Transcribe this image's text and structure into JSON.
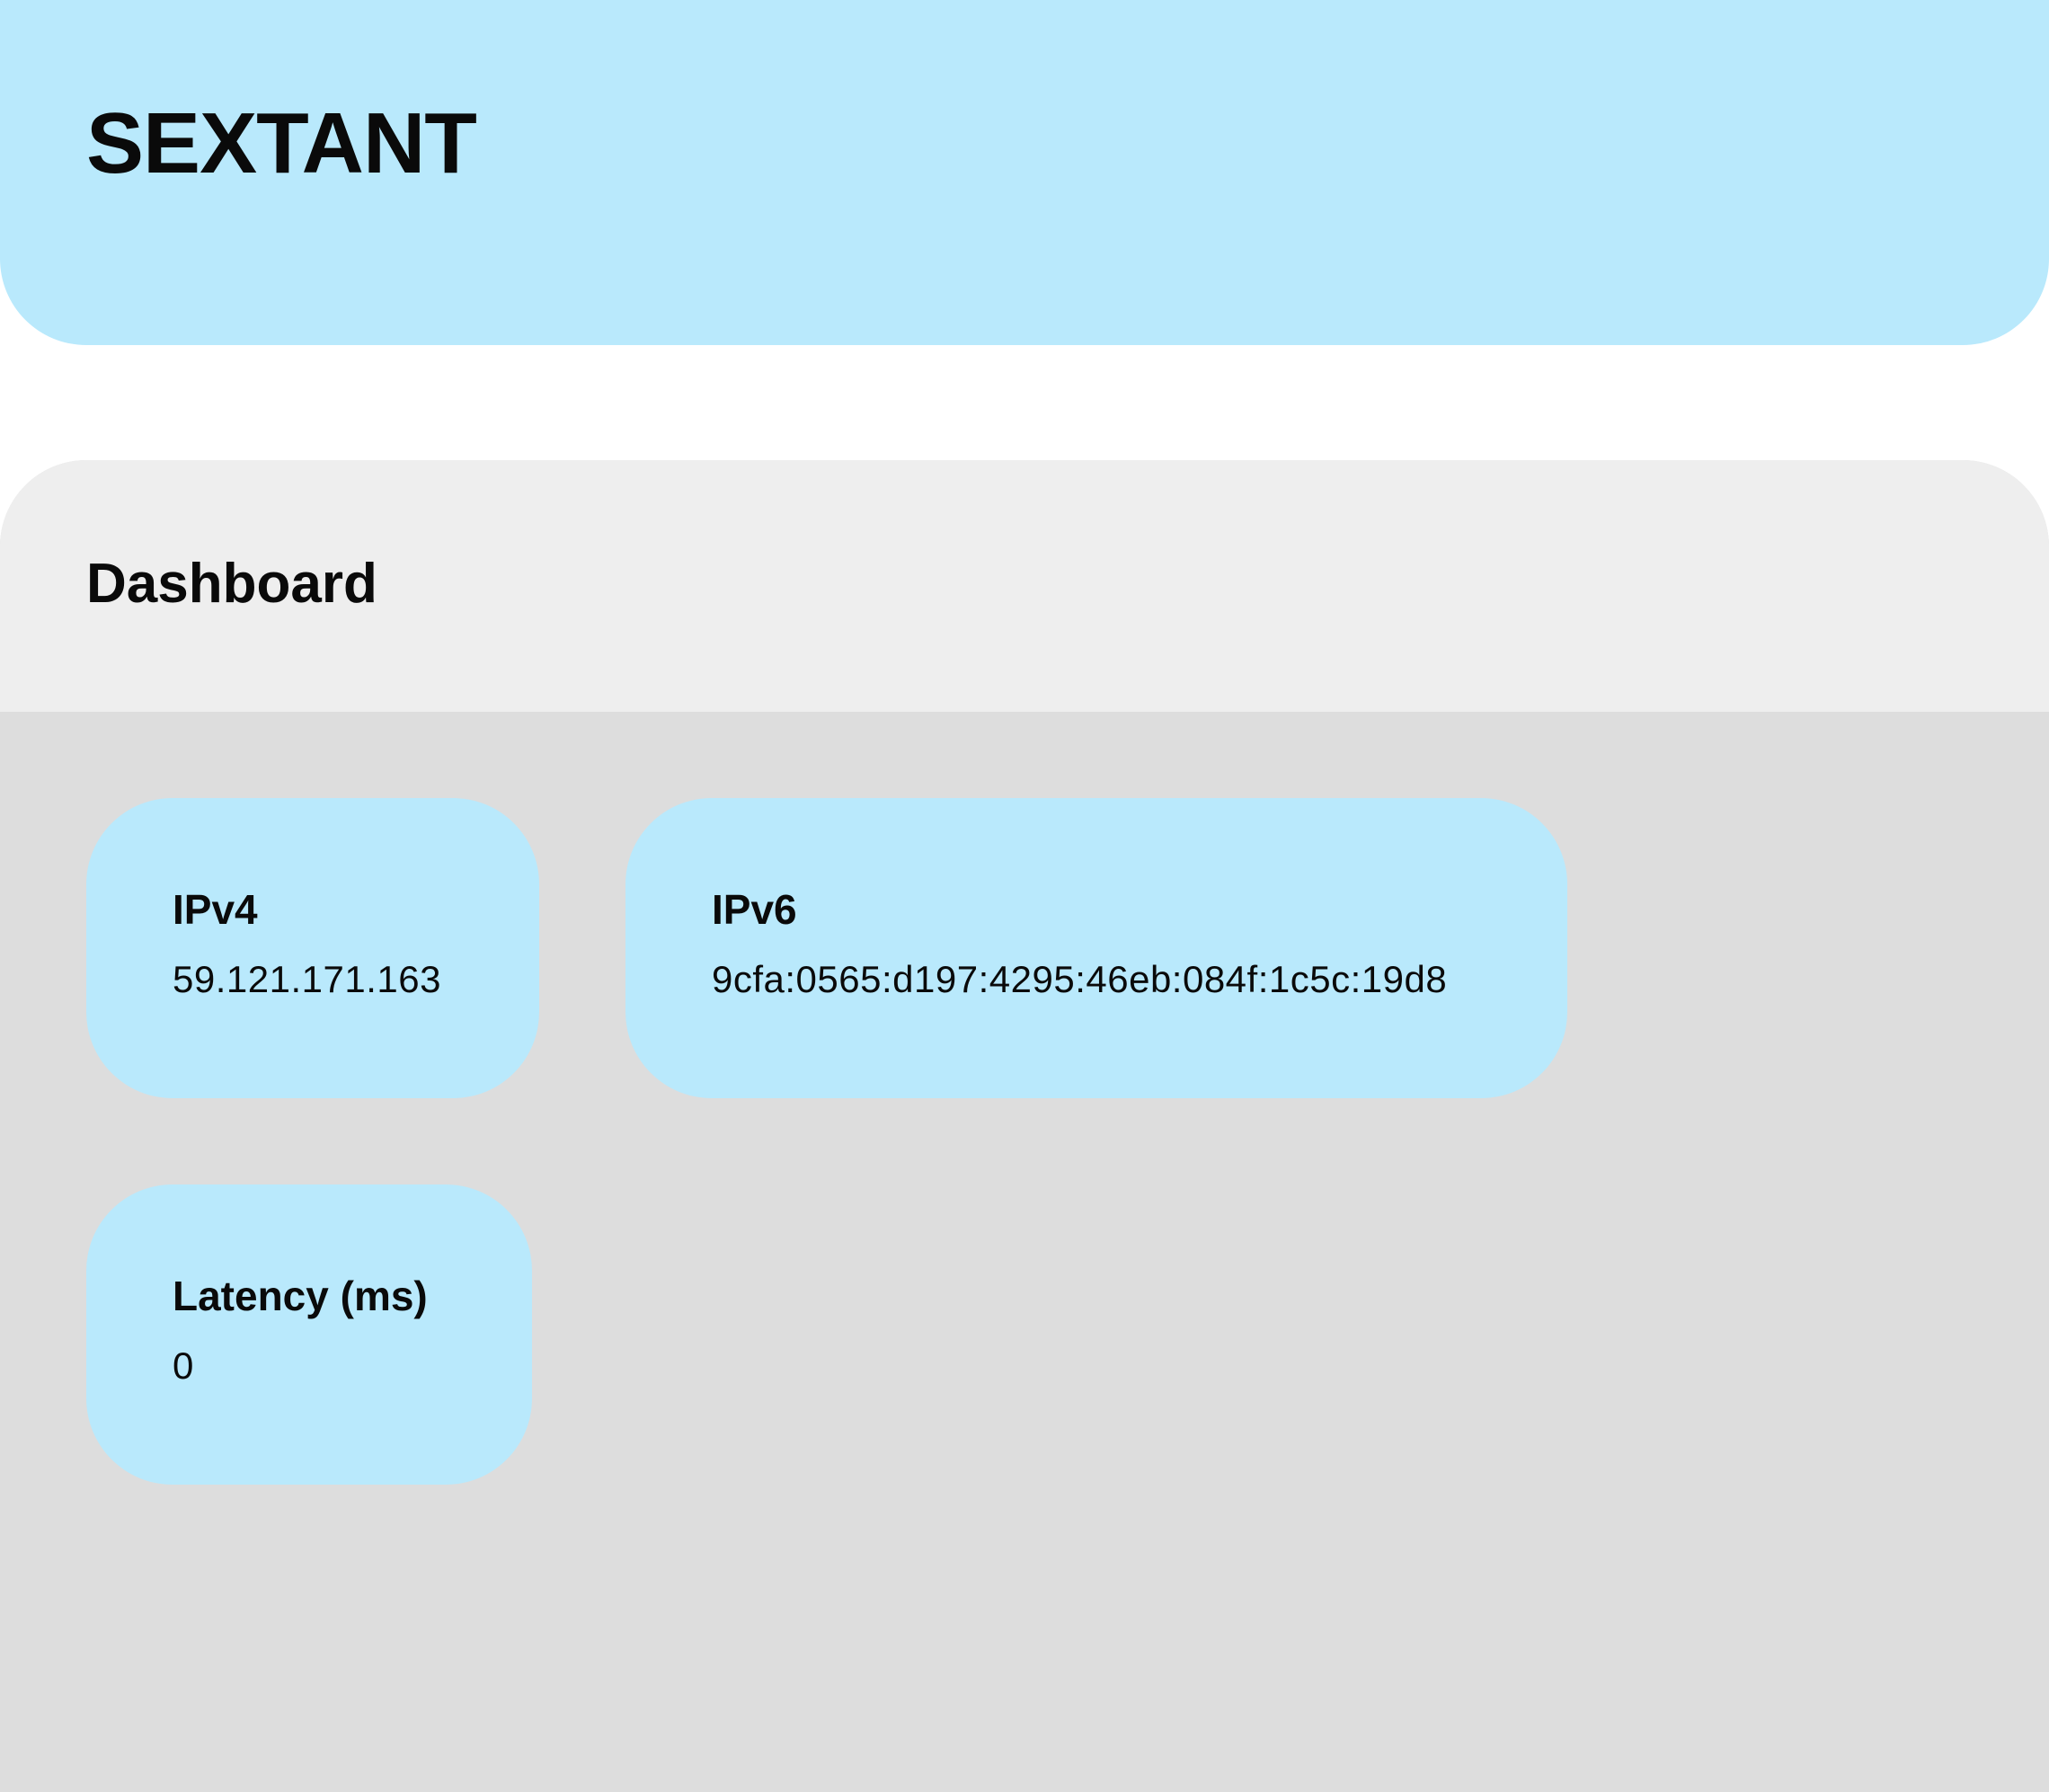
{
  "header": {
    "brand": "SEXTANT"
  },
  "dashboard": {
    "title": "Dashboard",
    "cards": [
      {
        "label": "IPv4",
        "value": "59.121.171.163"
      },
      {
        "label": "IPv6",
        "value": "9cfa:0565:d197:4295:46eb:084f:1c5c:19d8"
      },
      {
        "label": "Latency (ms)",
        "value": "0"
      }
    ]
  },
  "colors": {
    "accent": "#b9e9fc",
    "panel_header": "#eeeeee",
    "panel_body": "#dddddd",
    "text": "#0a0a0a"
  }
}
